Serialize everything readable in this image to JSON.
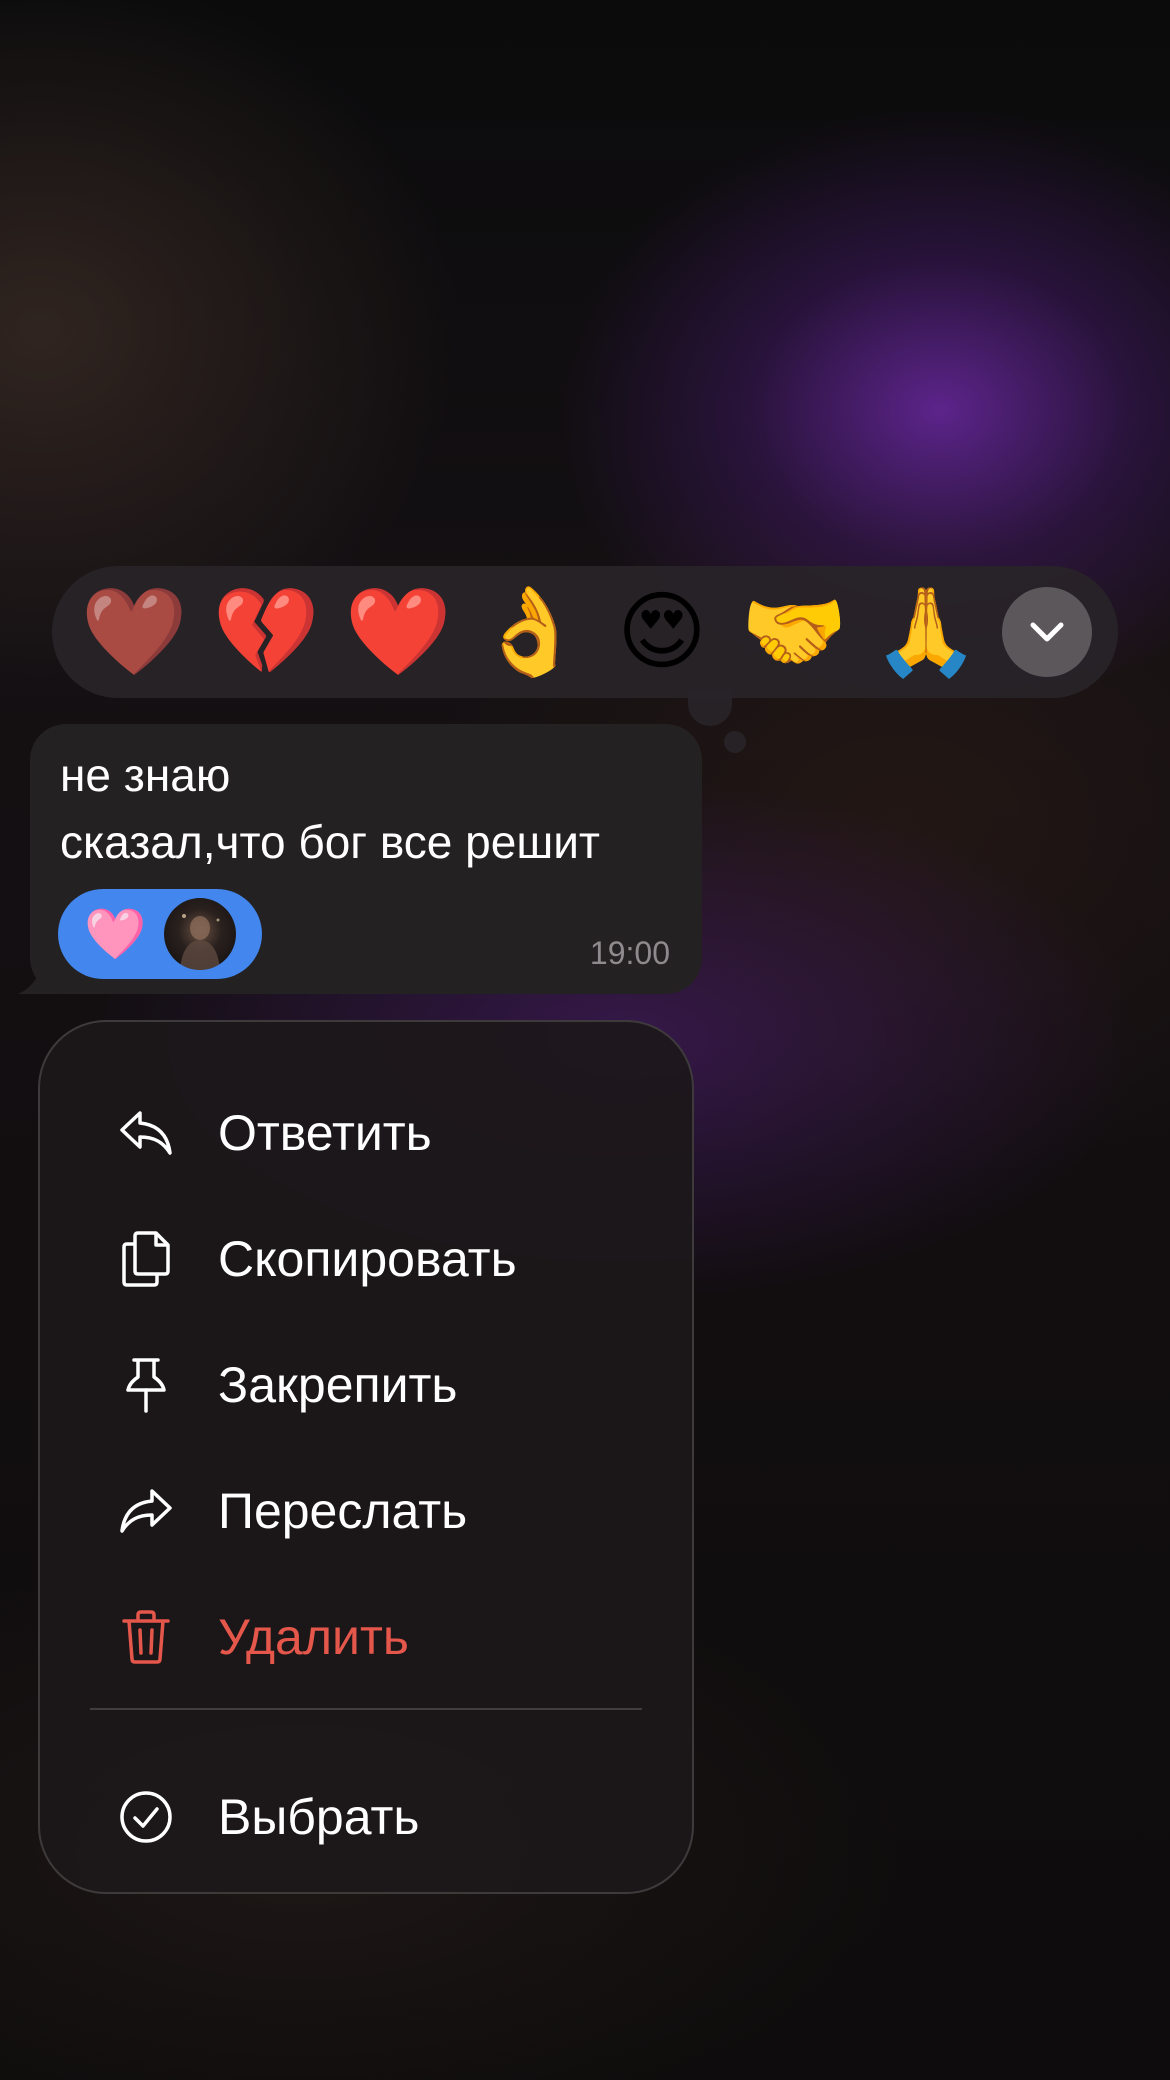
{
  "reactions": [
    {
      "emoji": "❤️",
      "icon": "heart-candy-icon"
    },
    {
      "emoji": "💔",
      "icon": "broken-heart-icon"
    },
    {
      "emoji": "❤️",
      "icon": "red-heart-icon"
    },
    {
      "emoji": "👌",
      "icon": "ok-hand-icon"
    },
    {
      "emoji": "😍",
      "icon": "heart-eyes-icon"
    },
    {
      "emoji": "🤝",
      "icon": "handshake-icon"
    },
    {
      "emoji": "🙏",
      "icon": "folded-hands-icon"
    }
  ],
  "expand_icon": "chevron-down-icon",
  "message": {
    "lines": [
      "не знаю",
      "сказал,что бог все решит"
    ],
    "reaction": {
      "emoji": "🩷",
      "icon": "pink-heart-icon"
    },
    "time": "19:00"
  },
  "menu": {
    "items": [
      {
        "label": "Ответить",
        "icon": "reply-icon"
      },
      {
        "label": "Скопировать",
        "icon": "copy-icon"
      },
      {
        "label": "Закрепить",
        "icon": "pin-icon"
      },
      {
        "label": "Переслать",
        "icon": "forward-icon"
      },
      {
        "label": "Удалить",
        "icon": "trash-icon",
        "danger": true
      }
    ],
    "select_label": "Выбрать",
    "select_icon": "checkmark-circle-icon"
  },
  "colors": {
    "accent": "#4286ee",
    "danger": "#e5574b",
    "menu_bg": "#1c181a",
    "bubble_bg": "#242123"
  }
}
